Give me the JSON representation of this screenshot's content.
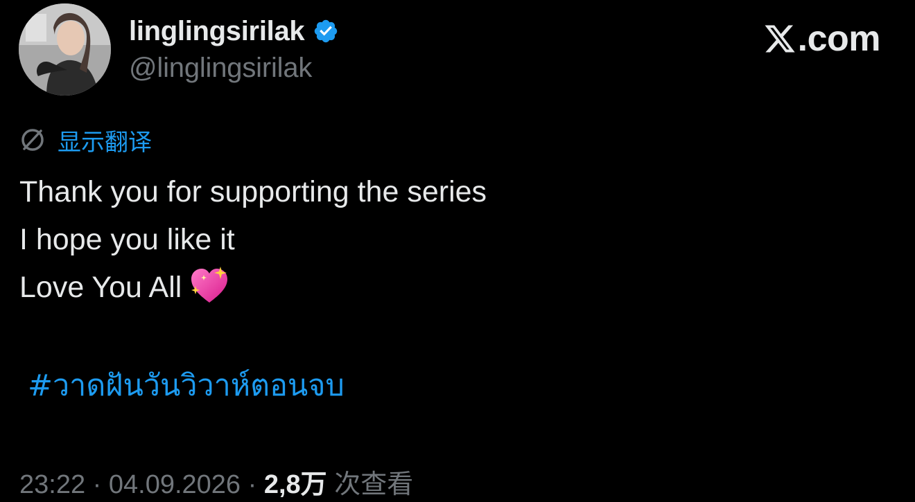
{
  "app": {
    "brand": "X.com",
    "brand_icon": "x-logo-icon"
  },
  "author": {
    "display_name": "linglingsirilak",
    "handle": "@linglingsirilak",
    "verified": true,
    "verified_icon": "verified-badge-icon",
    "avatar": "avatar-photo"
  },
  "translate": {
    "icon": "globe-icon",
    "label": "显示翻译"
  },
  "tweet": {
    "lines": [
      "Thank you for supporting the series",
      "I hope you like it",
      "Love You All"
    ],
    "emoji_icon": "sparkling-heart-icon",
    "hashtag": "#วาดฝันวันวิวาห์ตอนจบ"
  },
  "meta": {
    "time": "23:22",
    "separator": " · ",
    "date": "04.09.2026",
    "views_count": "2,8万",
    "views_label": "次查看"
  },
  "colors": {
    "background": "#000000",
    "text": "#e7e9ea",
    "secondary": "#71767b",
    "accent": "#1d9bf0"
  }
}
